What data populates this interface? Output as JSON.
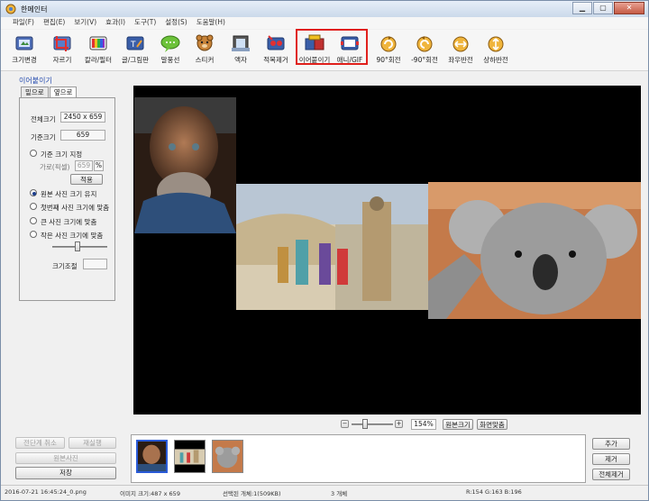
{
  "window": {
    "title": "한메인터"
  },
  "menu": [
    "파일(F)",
    "편집(E)",
    "보기(V)",
    "효과(I)",
    "도구(T)",
    "설정(S)",
    "도움말(H)"
  ],
  "toolbar": [
    {
      "label": "크기변경",
      "icon": "resize-icon"
    },
    {
      "label": "자르기",
      "icon": "crop-icon"
    },
    {
      "label": "칼라/필터",
      "icon": "color-filter-icon"
    },
    {
      "label": "글/그림판",
      "icon": "text-draw-icon"
    },
    {
      "label": "말풍선",
      "icon": "speech-bubble-icon"
    },
    {
      "label": "스티커",
      "icon": "sticker-icon"
    },
    {
      "label": "액자",
      "icon": "frame-icon"
    },
    {
      "label": "적목제거",
      "icon": "red-eye-icon"
    },
    {
      "label": "이어붙이기",
      "icon": "join-images-icon"
    },
    {
      "label": "애니/GIF",
      "icon": "animated-gif-icon"
    },
    {
      "label": "90°회전",
      "icon": "rotate-right-icon"
    },
    {
      "label": "-90°회전",
      "icon": "rotate-left-icon"
    },
    {
      "label": "좌우반전",
      "icon": "flip-horizontal-icon"
    },
    {
      "label": "상하반전",
      "icon": "flip-vertical-icon"
    }
  ],
  "panel": {
    "section_title": "이어붙이기",
    "tabs": [
      "밑으로",
      "옆으로"
    ],
    "total_size_label": "전체크기",
    "total_size_value": "2450 x 659",
    "base_size_label": "기준크기",
    "base_size_value": "659",
    "options": [
      "기준 크기 지정",
      "원본 사진 크기 유지",
      "첫번째 사진 크기에 맞춤",
      "큰 사진 크기에 맞춤",
      "작은 사진 크기에 맞춤"
    ],
    "selected_option": 1,
    "height_label": "가로(픽셀)",
    "height_value": "659",
    "percent_symbol": "%",
    "apply_label": "적용",
    "size_adjust_label": "크기조절",
    "slider_level": 0.45
  },
  "left_buttons": {
    "undo_all": "전단계 취소",
    "redo": "재실행",
    "original": "원본사진",
    "save": "저장"
  },
  "zoom": {
    "minus": "−",
    "plus": "+",
    "value": "154%",
    "original_size": "원본크기",
    "fit_screen": "화면맞춤",
    "level": 0.3
  },
  "right_buttons": {
    "add": "추가",
    "remove": "제거",
    "remove_all": "전체제거"
  },
  "status": {
    "file": "2016-07-21 16:45:24_0.png",
    "image_size": "이미지 크기:487 x 659",
    "selection": "선택된 개체:1(509KB)",
    "count": "3 개체",
    "color": "R:154 G:163 B:196"
  },
  "colors": {
    "canvas": "#000000",
    "highlight": "#e0201c",
    "selected_thumb": "#2a5bd8"
  }
}
